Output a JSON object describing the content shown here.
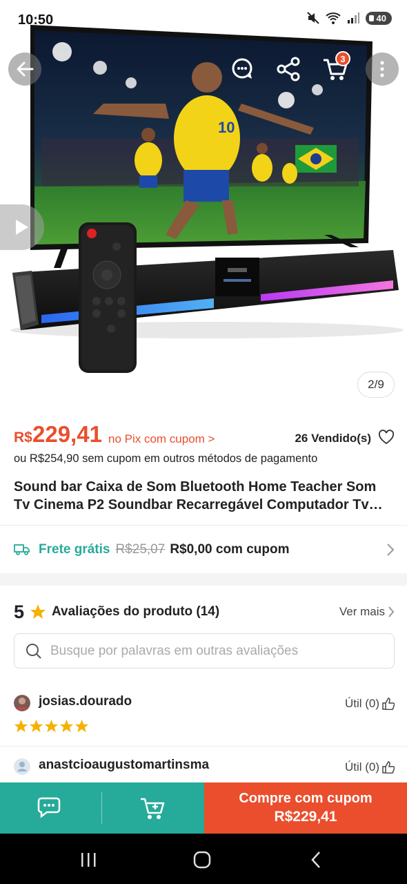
{
  "status_bar": {
    "time": "10:50",
    "battery": "40"
  },
  "gallery": {
    "counter": "2/9",
    "cart_count": "3"
  },
  "product": {
    "price_currency": "R$",
    "price_value": "229,41",
    "pix_link": "no Pix com cupom >",
    "sold": "26 Vendido(s)",
    "alt_price": "ou R$254,90 sem cupom em outros métodos de pagamento",
    "title": "Sound bar Caixa de Som Bluetooth Home Teacher Som Tv Cinema P2 Soundbar Recarregável Computador Tv Portátil"
  },
  "shipping": {
    "free_label": "Frete grátis",
    "old_price": "R$25,07",
    "new_price": "R$0,00 com cupom"
  },
  "reviews": {
    "score": "5",
    "title": "Avaliações do produto (14)",
    "see_more": "Ver mais",
    "search_placeholder": "Busque por palavras em outras avaliações",
    "items": [
      {
        "user": "josias.dourado",
        "useful": "Útil (0)",
        "stars": 5
      },
      {
        "user": "anastcioaugustomartinsma",
        "useful": "Útil (0)"
      }
    ]
  },
  "bottom_bar": {
    "buy_line1": "Compre com cupom",
    "buy_line2": "R$229,41"
  },
  "colors": {
    "accent": "#ea4e2d",
    "teal": "#26aa99",
    "star": "#f5b100"
  },
  "icons": [
    "back-arrow-icon",
    "chat-icon",
    "share-icon",
    "cart-icon",
    "more-icon",
    "play-icon",
    "heart-icon",
    "truck-icon",
    "chevron-right-icon",
    "star-icon",
    "search-icon",
    "thumbs-up-icon",
    "cart-plus-icon"
  ]
}
